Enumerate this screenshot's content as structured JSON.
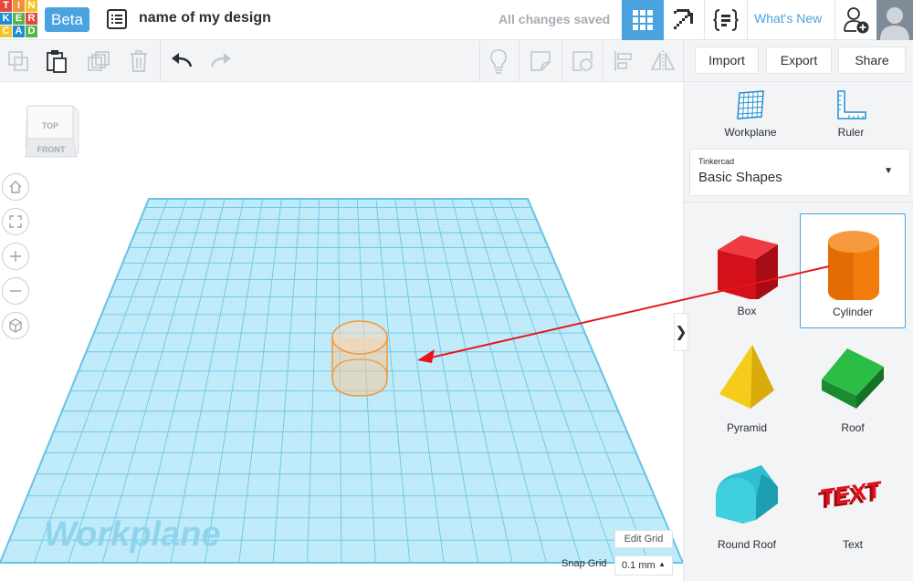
{
  "app": {
    "logo_letters": [
      "T",
      "I",
      "N",
      "K",
      "E",
      "R",
      "C",
      "A",
      "D"
    ],
    "logo_colors": [
      "#e2483c",
      "#f2903c",
      "#f2c42c",
      "#1f8ed1",
      "#56b448",
      "#e2483c",
      "#f2c42c",
      "#1f8ed1",
      "#56b448"
    ],
    "beta_label": "Beta",
    "design_name": "name of my design",
    "save_status": "All changes saved",
    "whats_new": "What's New",
    "accent_color": "#4aa3df"
  },
  "topbar": {
    "icons": [
      "design-list-icon",
      "3d-grid-icon",
      "pickaxe-icon",
      "code-blocks-icon",
      "add-user-icon",
      "avatar"
    ]
  },
  "toolbar": {
    "import_label": "Import",
    "export_label": "Export",
    "share_label": "Share",
    "icons": [
      "copy-icon",
      "paste-icon",
      "duplicate-icon",
      "delete-icon",
      "undo-icon",
      "redo-icon",
      "light-bulb-icon",
      "note-icon",
      "view-icon",
      "align-icon",
      "mirror-icon"
    ]
  },
  "viewport": {
    "viewcube_top": "TOP",
    "viewcube_front": "FRONT",
    "workplane_watermark": "Workplane",
    "edit_grid_label": "Edit Grid",
    "snap_grid_label": "Snap Grid",
    "snap_grid_value": "0.1 mm",
    "grid_color": "#86d3ee",
    "nav_buttons": [
      "home-view-icon",
      "fit-view-icon",
      "zoom-in-icon",
      "zoom-out-icon",
      "perspective-icon"
    ]
  },
  "panel": {
    "workplane_label": "Workplane",
    "ruler_label": "Ruler",
    "library_category": "Tinkercad",
    "library_name": "Basic Shapes",
    "collapse_glyph": "❯",
    "shapes": [
      {
        "label": "Box",
        "color": "#e0111d"
      },
      {
        "label": "Cylinder",
        "color": "#f27d0c",
        "selected": true
      },
      {
        "label": "Pyramid",
        "color": "#f6cc1a"
      },
      {
        "label": "Roof",
        "color": "#21a53b"
      },
      {
        "label": "Round Roof",
        "color": "#30bfd0"
      },
      {
        "label": "Text",
        "color": "#e0111d"
      }
    ]
  },
  "annotation": {
    "arrow_color": "#e8151b"
  }
}
